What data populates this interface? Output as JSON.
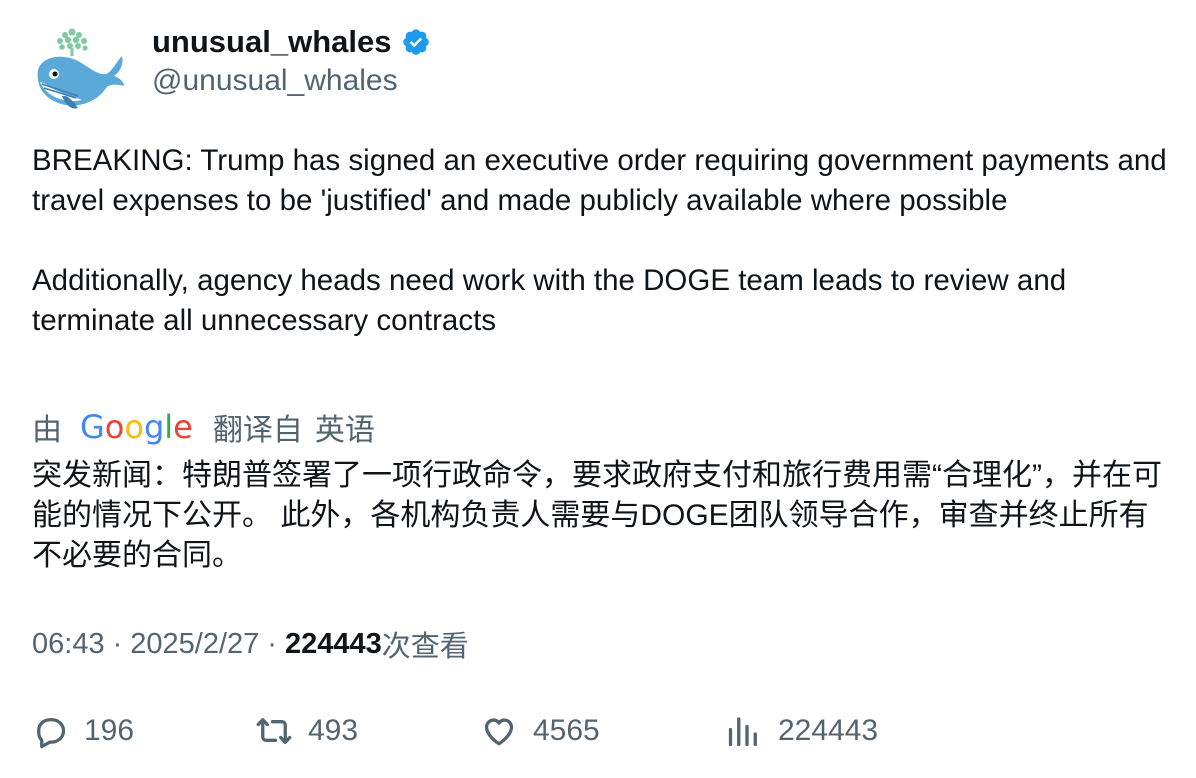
{
  "author": {
    "display_name": "unusual_whales",
    "handle": "@unusual_whales",
    "verified": true,
    "verified_color": "#1d9bf0",
    "avatar_icon": "whale-icon"
  },
  "tweet": {
    "text": "BREAKING: Trump has signed an executive order requiring government payments and travel expenses to be 'justified' and made publicly available where possible\n\nAdditionally, agency heads need work with the DOGE team leads to review and terminate all unnecessary contracts"
  },
  "translation": {
    "by": "由",
    "provider_letters": [
      "G",
      "o",
      "o",
      "g",
      "l",
      "e"
    ],
    "label": "翻译自",
    "language": "英语",
    "text": "突发新闻：特朗普签署了一项行政命令，要求政府支付和旅行费用需“合理化”，并在可能的情况下公开。 此外，各机构负责人需要与DOGE团队领导合作，审查并终止所有不必要的合同。"
  },
  "meta": {
    "time": "06:43",
    "separator": "·",
    "date": "2025/2/27",
    "views": "224443",
    "views_suffix": "次查看"
  },
  "actions": {
    "replies": "196",
    "retweets": "493",
    "likes": "4565",
    "views": "224443"
  },
  "colors": {
    "text": "#0f1419",
    "secondary": "#536471",
    "google_blue": "#4285f4",
    "google_red": "#ea4335",
    "google_yellow": "#fbbc05",
    "google_green": "#34a853"
  }
}
